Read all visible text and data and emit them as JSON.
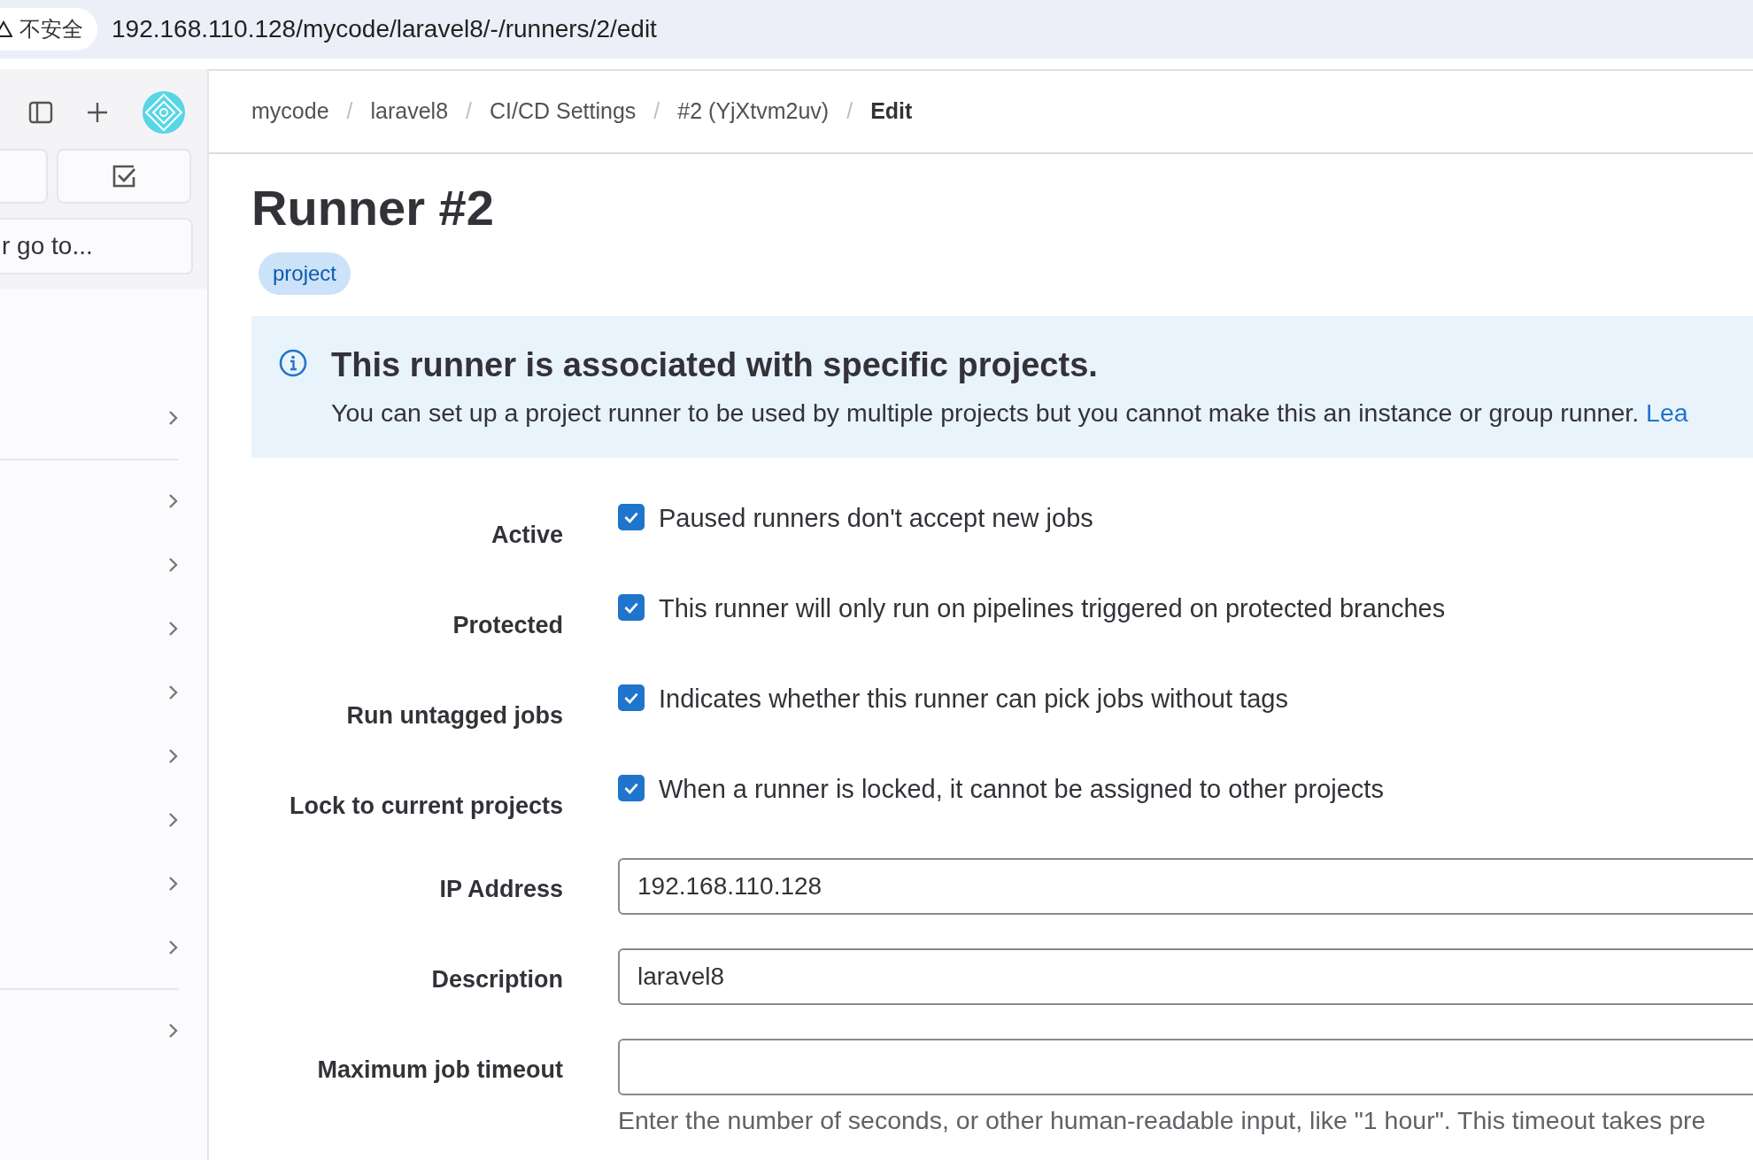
{
  "browser": {
    "security_label": "不安全",
    "url": "192.168.110.128/mycode/laravel8/-/runners/2/edit"
  },
  "sidebar": {
    "search_placeholder": "r go to...",
    "sections": [
      {
        "items": [
          {
            "expanded": false
          }
        ]
      },
      {
        "items": [
          {
            "expanded": false
          },
          {
            "expanded": false
          },
          {
            "expanded": false
          },
          {
            "expanded": false
          },
          {
            "expanded": false
          },
          {
            "expanded": false
          },
          {
            "expanded": false
          },
          {
            "expanded": false
          }
        ]
      },
      {
        "items": [
          {
            "expanded": false
          }
        ]
      }
    ]
  },
  "breadcrumb_separator": "/",
  "breadcrumbs": [
    {
      "label": "mycode",
      "current": false
    },
    {
      "label": "laravel8",
      "current": false
    },
    {
      "label": "CI/CD Settings",
      "current": false
    },
    {
      "label": "#2 (YjXtvm2uv)",
      "current": false
    },
    {
      "label": "Edit",
      "current": true
    }
  ],
  "title": "Runner #2",
  "badge": "project",
  "alert": {
    "title": "This runner is associated with specific projects.",
    "text": "You can set up a project runner to be used by multiple projects but you cannot make this an instance or group runner.",
    "link": "Lea"
  },
  "fields": [
    {
      "kind": "checkbox",
      "label": "Active",
      "checked": true,
      "description": "Paused runners don't accept new jobs"
    },
    {
      "kind": "checkbox",
      "label": "Protected",
      "checked": true,
      "description": "This runner will only run on pipelines triggered on protected branches"
    },
    {
      "kind": "checkbox",
      "label": "Run untagged jobs",
      "checked": true,
      "description": "Indicates whether this runner can pick jobs without tags"
    },
    {
      "kind": "checkbox",
      "label": "Lock to current projects",
      "checked": true,
      "description": "When a runner is locked, it cannot be assigned to other projects"
    },
    {
      "kind": "text",
      "label": "IP Address",
      "value": "192.168.110.128"
    },
    {
      "kind": "text",
      "label": "Description",
      "value": "laravel8"
    },
    {
      "kind": "text",
      "label": "Maximum job timeout",
      "help": "Enter the number of seconds, or other human-readable input, like \"1 hour\". This timeout takes pre"
    }
  ]
}
